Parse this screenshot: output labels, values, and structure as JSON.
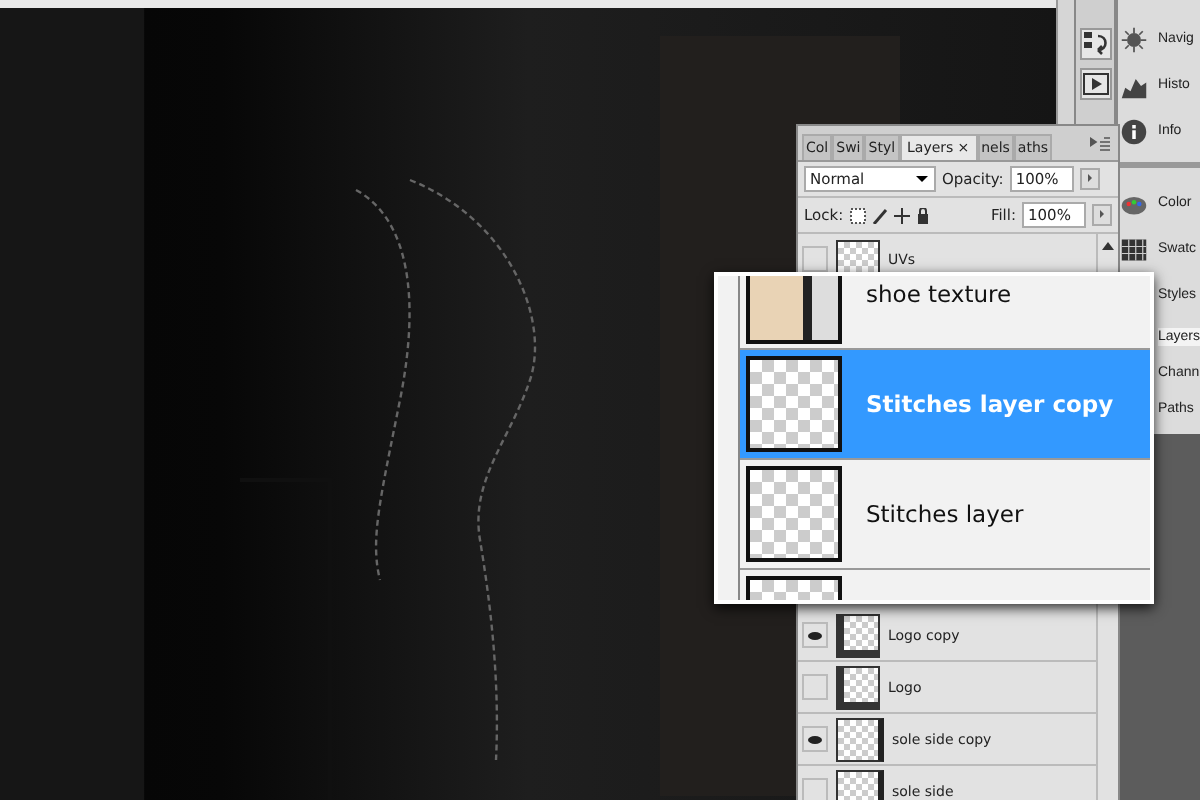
{
  "dock": {
    "groups": [
      {
        "items": [
          {
            "label": "Navig",
            "selected": false
          },
          {
            "label": "Histo",
            "selected": false
          },
          {
            "label": "Info",
            "selected": false
          }
        ]
      },
      {
        "items": [
          {
            "label": "Color",
            "selected": false
          },
          {
            "label": "Swatc",
            "selected": false
          },
          {
            "label": "Styles",
            "selected": false
          },
          {
            "label": "Layers",
            "selected": true
          },
          {
            "label": "Chann",
            "selected": false
          },
          {
            "label": "Paths",
            "selected": false
          }
        ]
      }
    ]
  },
  "layers_panel": {
    "tabs": [
      {
        "label": "Col",
        "selected": false
      },
      {
        "label": "Swi",
        "selected": false
      },
      {
        "label": "Styl",
        "selected": false
      },
      {
        "label": "Layers",
        "selected": true,
        "close": "×"
      },
      {
        "label": "nels",
        "selected": false
      },
      {
        "label": "aths",
        "selected": false
      }
    ],
    "blend_mode": "Normal",
    "opacity_label": "Opacity:",
    "opacity": "100%",
    "lock_label": "Lock:",
    "fill_label": "Fill:",
    "fill": "100%",
    "layers_top": [
      {
        "name": "UVs",
        "visible": false
      }
    ],
    "layers_bottom": [
      {
        "name": "Logo copy",
        "visible": true,
        "kind": "logo"
      },
      {
        "name": "Logo",
        "visible": false,
        "kind": "logo"
      },
      {
        "name": "sole side copy",
        "visible": true,
        "kind": "sole"
      },
      {
        "name": "sole side",
        "visible": false,
        "kind": "sole"
      }
    ]
  },
  "magnifier": {
    "rows": [
      {
        "name": "shoe texture",
        "selected": false,
        "kind": "photo"
      },
      {
        "name": "Stitches layer  copy",
        "selected": true,
        "kind": "empty"
      },
      {
        "name": "Stitches layer",
        "selected": false,
        "kind": "empty"
      },
      {
        "selected": false,
        "kind": "empty"
      }
    ]
  }
}
